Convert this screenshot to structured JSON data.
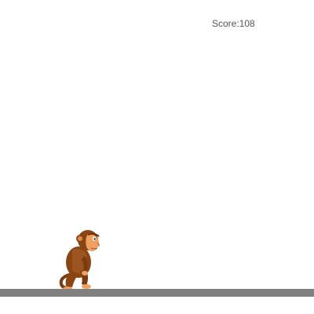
{
  "hud": {
    "score_label": "Score:",
    "score_value": "108"
  },
  "player": {
    "character_icon": "monkey-icon",
    "state": "running"
  },
  "colors": {
    "background": "#ffffff",
    "ground": "#808080",
    "score_text": "#555555",
    "fur": "#8b4513",
    "skin": "#f0a060"
  }
}
